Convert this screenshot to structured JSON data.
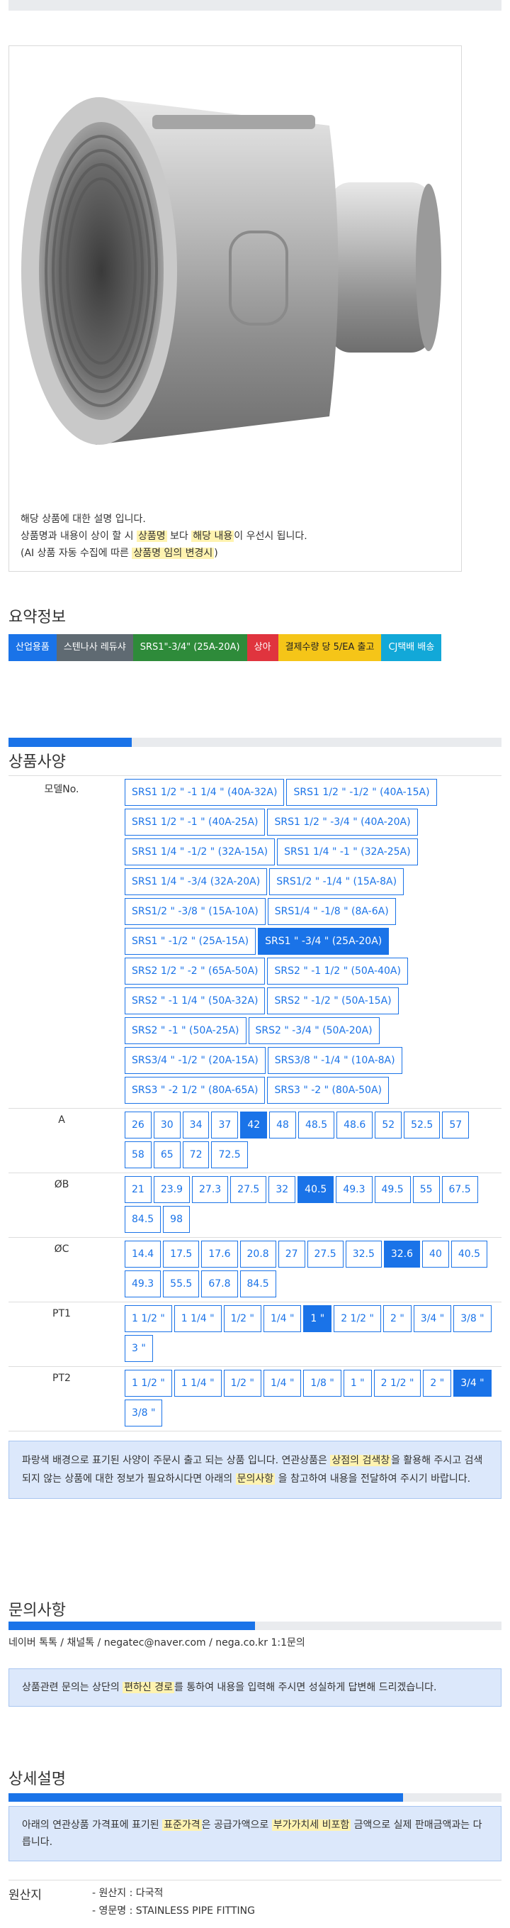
{
  "product": {
    "desc_line1": "해당 상품에 대한 설명 입니다.",
    "desc_line2_a": "상품명과 내용이 상이 할 시 ",
    "desc_line2_b": "상품명",
    "desc_line2_c": " 보다 ",
    "desc_line2_d": "해당 내용",
    "desc_line2_e": "이 우선시 됩니다.",
    "desc_line3_a": "(AI 상품 자동 수집에 따른 ",
    "desc_line3_b": "상품명 임의 변경시",
    "desc_line3_c": ")"
  },
  "summary": {
    "title": "요약정보",
    "tags": [
      {
        "label": "산업용품",
        "color": "#1a73e8"
      },
      {
        "label": "스텐나사 레듀샤",
        "color": "#5f6a72"
      },
      {
        "label": "SRS1\"-3/4\" (25A-20A)",
        "color": "#2e8b3a"
      },
      {
        "label": "상아",
        "color": "#e0343e"
      },
      {
        "label": "결제수량 당 5/EA 출고",
        "color": "#f5c518",
        "text": "#222222"
      },
      {
        "label": "CJ택배 배송",
        "color": "#12a8d8"
      }
    ]
  },
  "spec": {
    "title": "상품사양",
    "progress": 0.25,
    "rows": [
      {
        "label": "모델No.",
        "selected": 11,
        "options": [
          "SRS1 1/2 \" -1 1/4 \" (40A-32A)",
          "SRS1 1/2 \" -1/2 \" (40A-15A)",
          "SRS1 1/2 \" -1 \" (40A-25A)",
          "SRS1 1/2 \" -3/4 \" (40A-20A)",
          "SRS1 1/4 \" -1/2 \" (32A-15A)",
          "SRS1 1/4 \" -1 \" (32A-25A)",
          "SRS1 1/4 \" -3/4 (32A-20A)",
          "SRS1/2 \" -1/4 \" (15A-8A)",
          "SRS1/2 \" -3/8 \" (15A-10A)",
          "SRS1/4 \" -1/8 \" (8A-6A)",
          "SRS1 \" -1/2 \" (25A-15A)",
          "SRS1 \" -3/4 \" (25A-20A)",
          "SRS2 1/2 \" -2 \" (65A-50A)",
          "SRS2 \" -1 1/2 \" (50A-40A)",
          "SRS2 \" -1 1/4 \" (50A-32A)",
          "SRS2 \" -1/2 \" (50A-15A)",
          "SRS2 \" -1 \" (50A-25A)",
          "SRS2 \" -3/4 \" (50A-20A)",
          "SRS3/4 \" -1/2 \" (20A-15A)",
          "SRS3/8 \" -1/4 \" (10A-8A)",
          "SRS3 \" -2 1/2 \" (80A-65A)",
          "SRS3 \" -2 \" (80A-50A)"
        ]
      },
      {
        "label": "A",
        "selected": 4,
        "options": [
          "26",
          "30",
          "34",
          "37",
          "42",
          "48",
          "48.5",
          "48.6",
          "52",
          "52.5",
          "57",
          "58",
          "65",
          "72",
          "72.5"
        ]
      },
      {
        "label": "ØB",
        "selected": 5,
        "options": [
          "21",
          "23.9",
          "27.3",
          "27.5",
          "32",
          "40.5",
          "49.3",
          "49.5",
          "55",
          "67.5",
          "84.5",
          "98"
        ]
      },
      {
        "label": "ØC",
        "selected": 7,
        "options": [
          "14.4",
          "17.5",
          "17.6",
          "20.8",
          "27",
          "27.5",
          "32.5",
          "32.6",
          "40",
          "40.5",
          "49.3",
          "55.5",
          "67.8",
          "84.5"
        ]
      },
      {
        "label": "PT1",
        "selected": 4,
        "options": [
          "1 1/2 \"",
          "1 1/4 \"",
          "1/2 \"",
          "1/4 \"",
          "1 \"",
          "2 1/2 \"",
          "2 \"",
          "3/4 \"",
          "3/8 \"",
          "3 \""
        ]
      },
      {
        "label": "PT2",
        "selected": 8,
        "options": [
          "1 1/2 \"",
          "1 1/4 \"",
          "1/2 \"",
          "1/4 \"",
          "1/8 \"",
          "1 \"",
          "2 1/2 \"",
          "2 \"",
          "3/4 \"",
          "3/8 \""
        ]
      }
    ],
    "notice_a": "파랑색 배경으로 표기된 사양이 주문시 출고 되는 상품 입니다. 연관상품은 ",
    "notice_b": "상점의 검색창",
    "notice_c": "을 활용해 주시고 검색되지 않는 상품에 대한 정보가 필요하시다면 아래의 ",
    "notice_d": "문의사항",
    "notice_e": " 을 참고하여 내용을 전달하여 주시기 바랍니다."
  },
  "inquiry": {
    "title": "문의사항",
    "progress": 0.5,
    "contact": "네이버 톡톡 / 채널톡 / negatec@naver.com / nega.co.kr 1:1문의",
    "notice_a": "상품관련 문의는 상단의 ",
    "notice_b": "편하신 경로",
    "notice_c": "를 통하여 내용을 입력해 주시면 성실하게 답변해 드리겠습니다."
  },
  "detail": {
    "title": "상세설명",
    "progress": 0.8,
    "notice_a": "아래의 연관상품 가격표에 표기된 ",
    "notice_b": "표준가격",
    "notice_c": "은 공급가액으로 ",
    "notice_d": "부가가치세 비포함",
    "notice_e": " 금액으로 실제 판매금액과는 다릅니다."
  },
  "origin": {
    "label": "원산지",
    "line1": "- 원산지 : 다국적",
    "line2": "- 영문명 : STAINLESS PIPE FITTING"
  }
}
